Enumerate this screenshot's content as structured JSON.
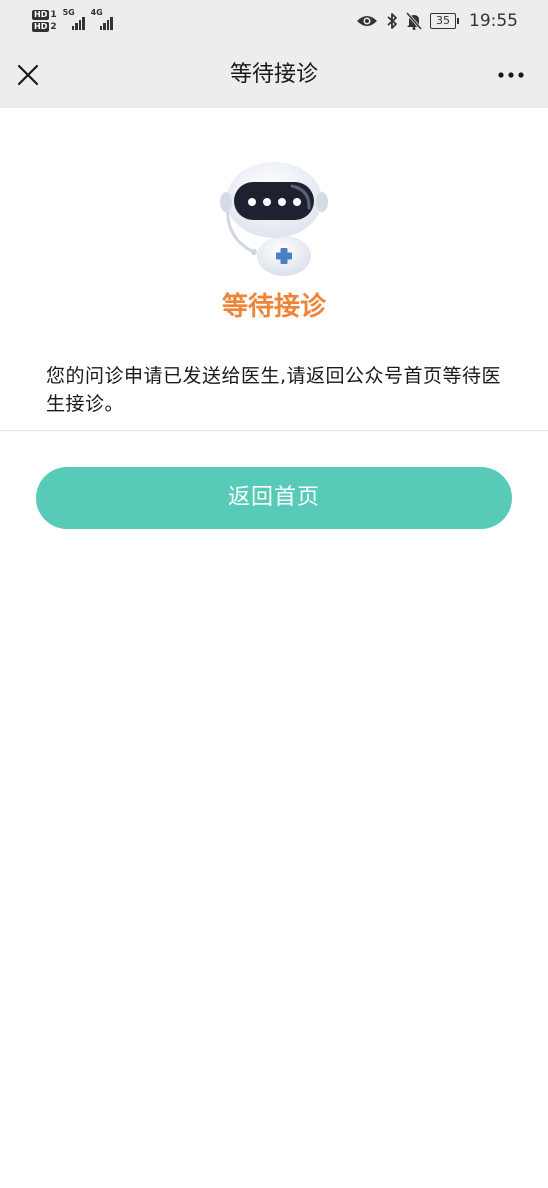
{
  "status_bar": {
    "sim1_badge": "HD",
    "sim1_num": "1",
    "sim2_badge": "HD",
    "sim2_num": "2",
    "network1": "5G",
    "network2": "4G",
    "battery_level": "35",
    "time": "19:55",
    "icons": [
      "eye-icon",
      "bluetooth-icon",
      "bell-off-icon",
      "battery-icon"
    ]
  },
  "navbar": {
    "title": "等待接诊",
    "left_icon": "close-icon",
    "right_icon": "more-icon"
  },
  "main": {
    "illustration": "robot-doctor-icon",
    "status_title": "等待接诊",
    "message": "您的问诊申请已发送给医生,请返回公众号首页等待医生接诊。",
    "button_label": "返回首页"
  },
  "colors": {
    "navbar_bg": "#ededed",
    "status_title": "#f08436",
    "button_bg": "#57cbb8",
    "button_text": "#ffffff"
  }
}
